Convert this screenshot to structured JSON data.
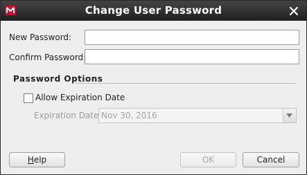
{
  "window": {
    "title": "Change User Password"
  },
  "fields": {
    "new_password_label": "New Password:",
    "new_password_value": "",
    "confirm_password_label": "Confirm Password:",
    "confirm_password_value": ""
  },
  "options": {
    "section_title": "Password Options",
    "allow_expiration_label": "Allow Expiration Date",
    "allow_expiration_checked": false,
    "expiration_date_label": "Expiration Date:",
    "expiration_date_value": "Nov 30, 2016"
  },
  "buttons": {
    "help_mnemonic": "H",
    "help_rest": "elp",
    "ok": "OK",
    "cancel": "Cancel"
  },
  "colors": {
    "titlebar": "#2e2e2e",
    "accent_icon": "#c8102e"
  }
}
